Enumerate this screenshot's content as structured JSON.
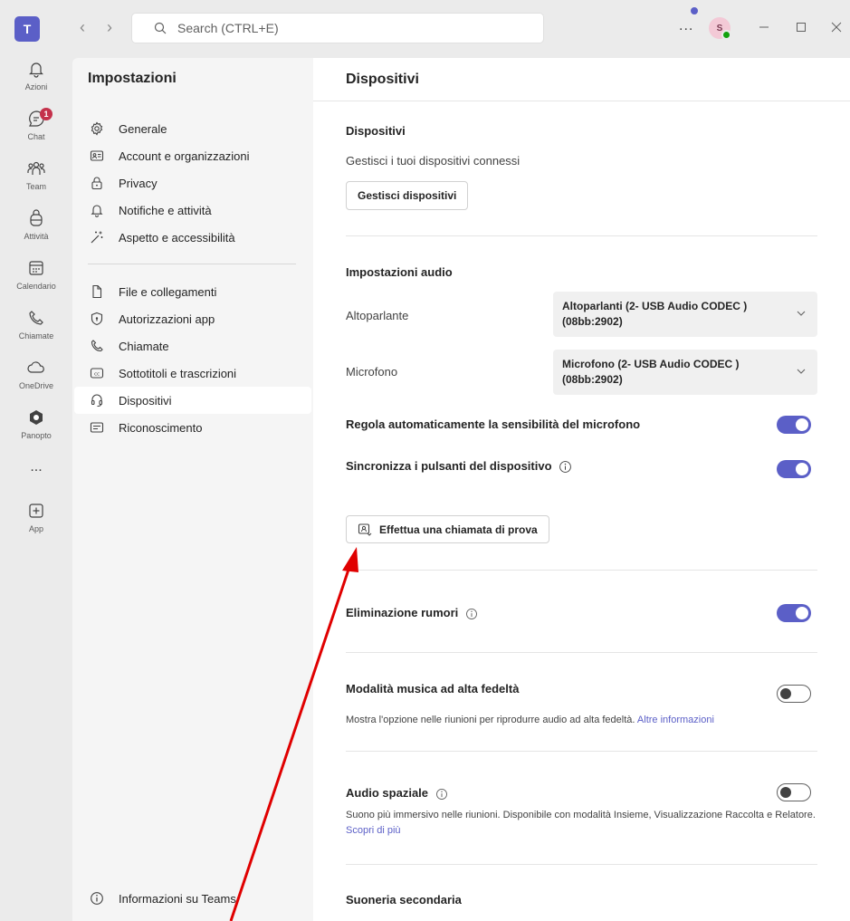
{
  "titlebar": {
    "logo_text": "T",
    "search_placeholder": "Search (CTRL+E)",
    "more_label": "...",
    "avatar_initial": "S"
  },
  "rail": {
    "items": [
      {
        "label": "Azioni"
      },
      {
        "label": "Chat",
        "badge": "1"
      },
      {
        "label": "Team"
      },
      {
        "label": "Attività"
      },
      {
        "label": "Calendario"
      },
      {
        "label": "Chiamate"
      },
      {
        "label": "OneDrive"
      },
      {
        "label": "Panopto"
      },
      {
        "label": "..."
      },
      {
        "label": "App"
      }
    ]
  },
  "settings_nav": {
    "title": "Impostazioni",
    "items": [
      {
        "label": "Generale"
      },
      {
        "label": "Account e organizzazioni"
      },
      {
        "label": "Privacy"
      },
      {
        "label": "Notifiche e attività"
      },
      {
        "label": "Aspetto e accessibilità"
      },
      {
        "label": "File e collegamenti"
      },
      {
        "label": "Autorizzazioni app"
      },
      {
        "label": "Chiamate"
      },
      {
        "label": "Sottotitoli e trascrizioni"
      },
      {
        "label": "Dispositivi"
      },
      {
        "label": "Riconoscimento"
      }
    ],
    "footer": "Informazioni su Teams"
  },
  "main": {
    "title": "Dispositivi",
    "devices": {
      "heading": "Dispositivi",
      "description": "Gestisci i tuoi dispositivi connessi",
      "manage_button": "Gestisci dispositivi"
    },
    "audio": {
      "heading": "Impostazioni audio",
      "speaker_label": "Altoparlante",
      "speaker_value_line1": "Altoparlanti (2- USB Audio CODEC )",
      "speaker_value_line2": "(08bb:2902)",
      "mic_label": "Microfono",
      "mic_value_line1": "Microfono (2- USB Audio CODEC )",
      "mic_value_line2": "(08bb:2902)",
      "auto_sensitivity": "Regola automaticamente la sensibilità del microfono",
      "sync_buttons": "Sincronizza i pulsanti del dispositivo",
      "test_call_button": "Effettua una chiamata di prova"
    },
    "noise": {
      "heading": "Eliminazione rumori"
    },
    "music": {
      "heading": "Modalità musica ad alta fedeltà",
      "description": "Mostra l'opzione nelle riunioni per riprodurre audio ad alta fedeltà.",
      "link": "Altre informazioni"
    },
    "spatial": {
      "heading": "Audio spaziale",
      "description": "Suono più immersivo nelle riunioni. Disponibile con modalità Insieme, Visualizzazione Raccolta e Relatore.",
      "link": "Scopri di più"
    },
    "ringer": {
      "heading": "Suoneria secondaria"
    }
  },
  "toggles": {
    "auto_sensitivity": true,
    "sync_buttons": true,
    "noise": true,
    "music": false,
    "spatial": false
  },
  "colors": {
    "accent": "#5b5fc7",
    "badge": "#c4314b",
    "presence": "#13a10e",
    "annotation_arrow": "#e00000"
  }
}
